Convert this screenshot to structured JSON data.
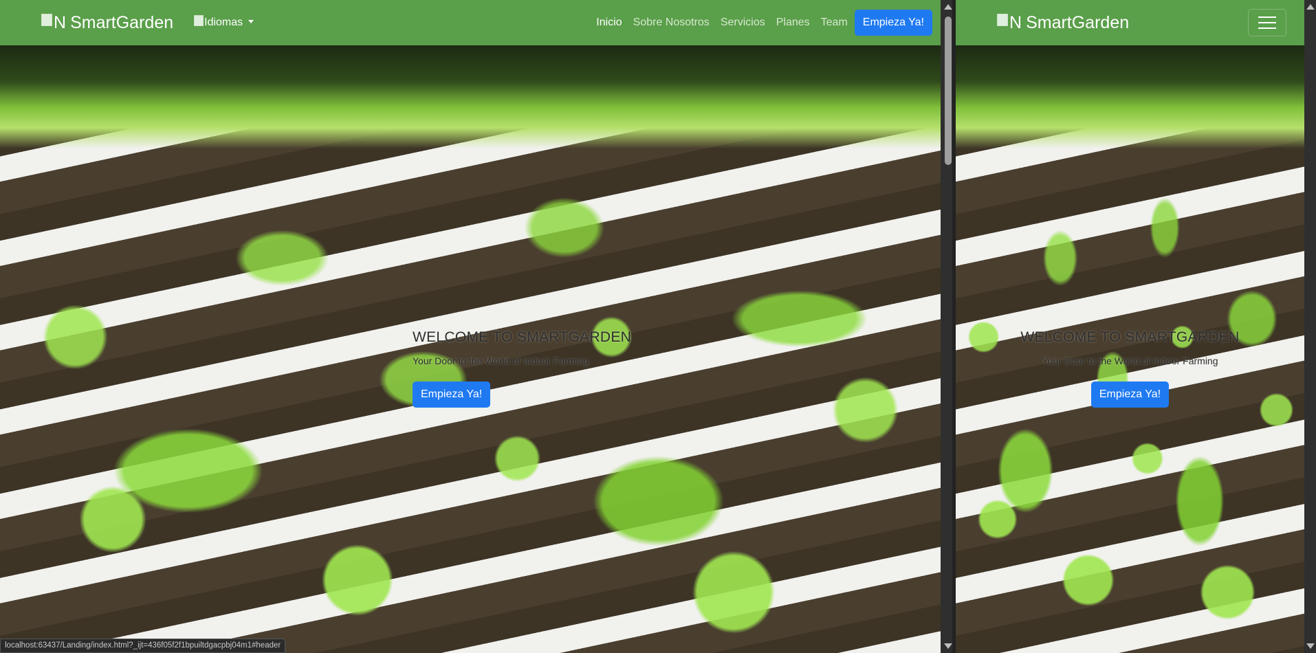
{
  "left": {
    "brand": {
      "icon_alt": "N",
      "name": "SmartGarden"
    },
    "lang_menu": {
      "alt": "Idiomas"
    },
    "nav": [
      "Inicio",
      "Sobre Nosotros",
      "Servicios",
      "Planes",
      "Team"
    ],
    "cta": "Empieza Ya!",
    "hero": {
      "title": "WELCOME TO SMARTGARDEN",
      "subtitle": "Your Door to the World of Indoor Farming",
      "button": "Empieza Ya!"
    },
    "status_url": "localhost:63437/Landing/index.html?_ijt=436f05f2f1bpuiltdgacpbj04m1#header"
  },
  "right": {
    "brand": {
      "icon_alt": "N",
      "name": "SmartGarden"
    },
    "hero": {
      "title": "WELCOME TO SMARTGARDEN",
      "subtitle": "Your Door to the World of Indoor Farming",
      "button": "Empieza Ya!"
    }
  }
}
